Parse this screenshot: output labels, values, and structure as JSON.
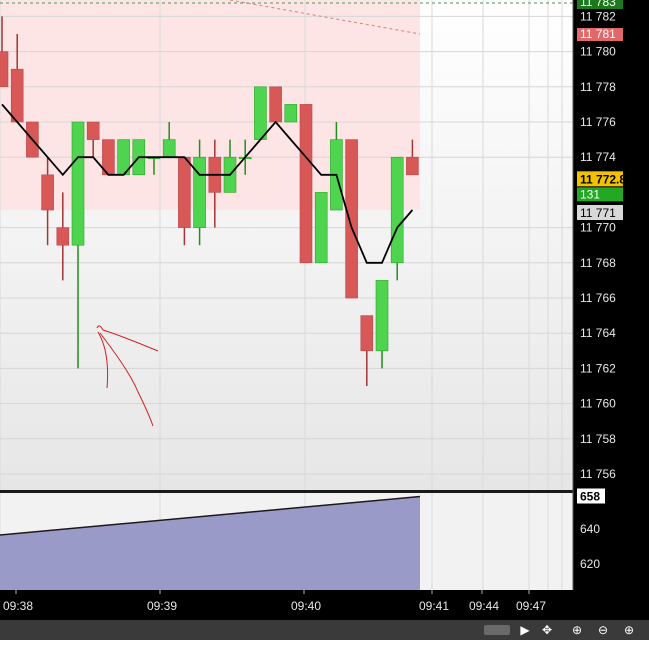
{
  "chart_data": {
    "type": "candlestick",
    "title": "",
    "price_axis": {
      "ticks": [
        "11 782",
        "11 780",
        "11 778",
        "11 776",
        "11 774",
        "11 770",
        "11 768",
        "11 766",
        "11 764",
        "11 762",
        "11 760",
        "11 758",
        "11 756"
      ],
      "tick_values": [
        11782,
        11780,
        11778,
        11776,
        11774,
        11770,
        11768,
        11766,
        11764,
        11762,
        11760,
        11758,
        11756
      ],
      "ylim": [
        11755,
        11783
      ]
    },
    "price_tags": {
      "top": {
        "label": "11 783",
        "value": 11783,
        "color": "#1c7a1c"
      },
      "upper": {
        "label": "11 781",
        "value": 11781,
        "color": "#e06868"
      },
      "last": {
        "label": "11 772.8",
        "value": 11772.8,
        "color": "#f2c200"
      },
      "countdown": {
        "label": "131",
        "color": "#22a822"
      },
      "ma": {
        "label": "11 771",
        "value": 11771,
        "color": "#d8d8d8"
      }
    },
    "time_axis": {
      "labels": [
        "09:38",
        "09:39",
        "09:40",
        "09:41",
        "09:44",
        "09:47"
      ]
    },
    "candles": [
      {
        "o": 11780,
        "h": 11782,
        "l": 11778,
        "c": 11778
      },
      {
        "o": 11779,
        "h": 11781,
        "l": 11776,
        "c": 11776
      },
      {
        "o": 11776,
        "h": 11776,
        "l": 11774,
        "c": 11774
      },
      {
        "o": 11773,
        "h": 11774,
        "l": 11769,
        "c": 11771
      },
      {
        "o": 11770,
        "h": 11772,
        "l": 11767,
        "c": 11769
      },
      {
        "o": 11769,
        "h": 11776,
        "l": 11762,
        "c": 11776
      },
      {
        "o": 11776,
        "h": 11776,
        "l": 11774,
        "c": 11775
      },
      {
        "o": 11775,
        "h": 11775,
        "l": 11773,
        "c": 11773
      },
      {
        "o": 11773,
        "h": 11775,
        "l": 11773,
        "c": 11775
      },
      {
        "o": 11773,
        "h": 11775,
        "l": 11773,
        "c": 11775
      },
      {
        "o": 11774,
        "h": 11774,
        "l": 11773,
        "c": 11774
      },
      {
        "o": 11774,
        "h": 11776,
        "l": 11774,
        "c": 11775
      },
      {
        "o": 11774,
        "h": 11774,
        "l": 11769,
        "c": 11770
      },
      {
        "o": 11770,
        "h": 11775,
        "l": 11769,
        "c": 11774
      },
      {
        "o": 11774,
        "h": 11775,
        "l": 11770,
        "c": 11772
      },
      {
        "o": 11772,
        "h": 11775,
        "l": 11772,
        "c": 11774
      },
      {
        "o": 11774,
        "h": 11775,
        "l": 11773,
        "c": 11774
      },
      {
        "o": 11775,
        "h": 11778,
        "l": 11775,
        "c": 11778
      },
      {
        "o": 11778,
        "h": 11778,
        "l": 11776,
        "c": 11776
      },
      {
        "o": 11776,
        "h": 11777,
        "l": 11776,
        "c": 11777
      },
      {
        "o": 11777,
        "h": 11777,
        "l": 11768,
        "c": 11768
      },
      {
        "o": 11768,
        "h": 11772,
        "l": 11768,
        "c": 11772
      },
      {
        "o": 11771,
        "h": 11776,
        "l": 11771,
        "c": 11775
      },
      {
        "o": 11775,
        "h": 11775,
        "l": 11766,
        "c": 11766
      },
      {
        "o": 11765,
        "h": 11765,
        "l": 11761,
        "c": 11763
      },
      {
        "o": 11763,
        "h": 11767,
        "l": 11762,
        "c": 11767
      },
      {
        "o": 11768,
        "h": 11774,
        "l": 11767,
        "c": 11774
      },
      {
        "o": 11774,
        "h": 11775,
        "l": 11773,
        "c": 11773
      }
    ],
    "ma_line": [
      11777,
      11776,
      11775,
      11774,
      11773,
      11774,
      11774,
      11773,
      11773,
      11774,
      11774,
      11774,
      11774,
      11773,
      11773,
      11773,
      11774,
      11775,
      11776,
      11775,
      11774,
      11773,
      11773,
      11770,
      11768,
      11768,
      11770,
      11771
    ],
    "volume_panel": {
      "ticks": [
        "640",
        "620"
      ],
      "tick_values": [
        640,
        620
      ],
      "ylim": [
        608,
        662
      ],
      "last": {
        "label": "658",
        "value": 658
      },
      "start_value": 636,
      "end_value": 658,
      "fill_color": "#9a9ac8"
    },
    "colors": {
      "up": "#4fd44f",
      "down": "#d85858",
      "zone": "#fde5e5"
    }
  }
}
